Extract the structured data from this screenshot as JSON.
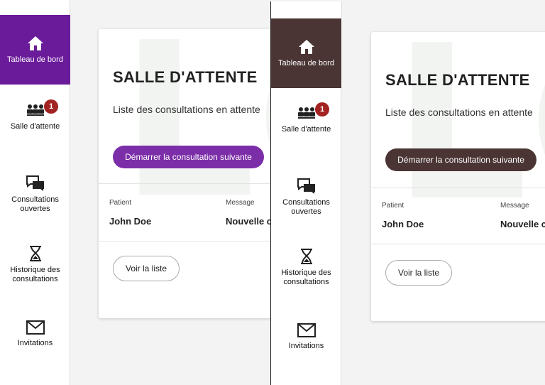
{
  "nav": {
    "items": [
      {
        "label": "Tableau de bord",
        "icon": "home-icon"
      },
      {
        "label": "Salle d'attente",
        "icon": "waiting-room-icon",
        "badge": "1"
      },
      {
        "label": "Consultations ouvertes",
        "icon": "chat-icon"
      },
      {
        "label": "Historique des consultations",
        "icon": "hourglass-icon"
      },
      {
        "label": "Invitations",
        "icon": "envelope-icon"
      }
    ]
  },
  "card": {
    "title": "SALLE D'ATTENTE",
    "subtitle": "Liste des consultations en attente",
    "start_button": "Démarrer la consultation suivante",
    "columns": {
      "patient_label": "Patient",
      "message_label": "Message"
    },
    "row": {
      "patient": "John Doe",
      "message": "Nouvelle consultation"
    },
    "list_button": "Voir la liste"
  },
  "colors": {
    "left_accent": "#6a1b9a",
    "right_accent": "#4a3434",
    "badge": "#a32222"
  }
}
